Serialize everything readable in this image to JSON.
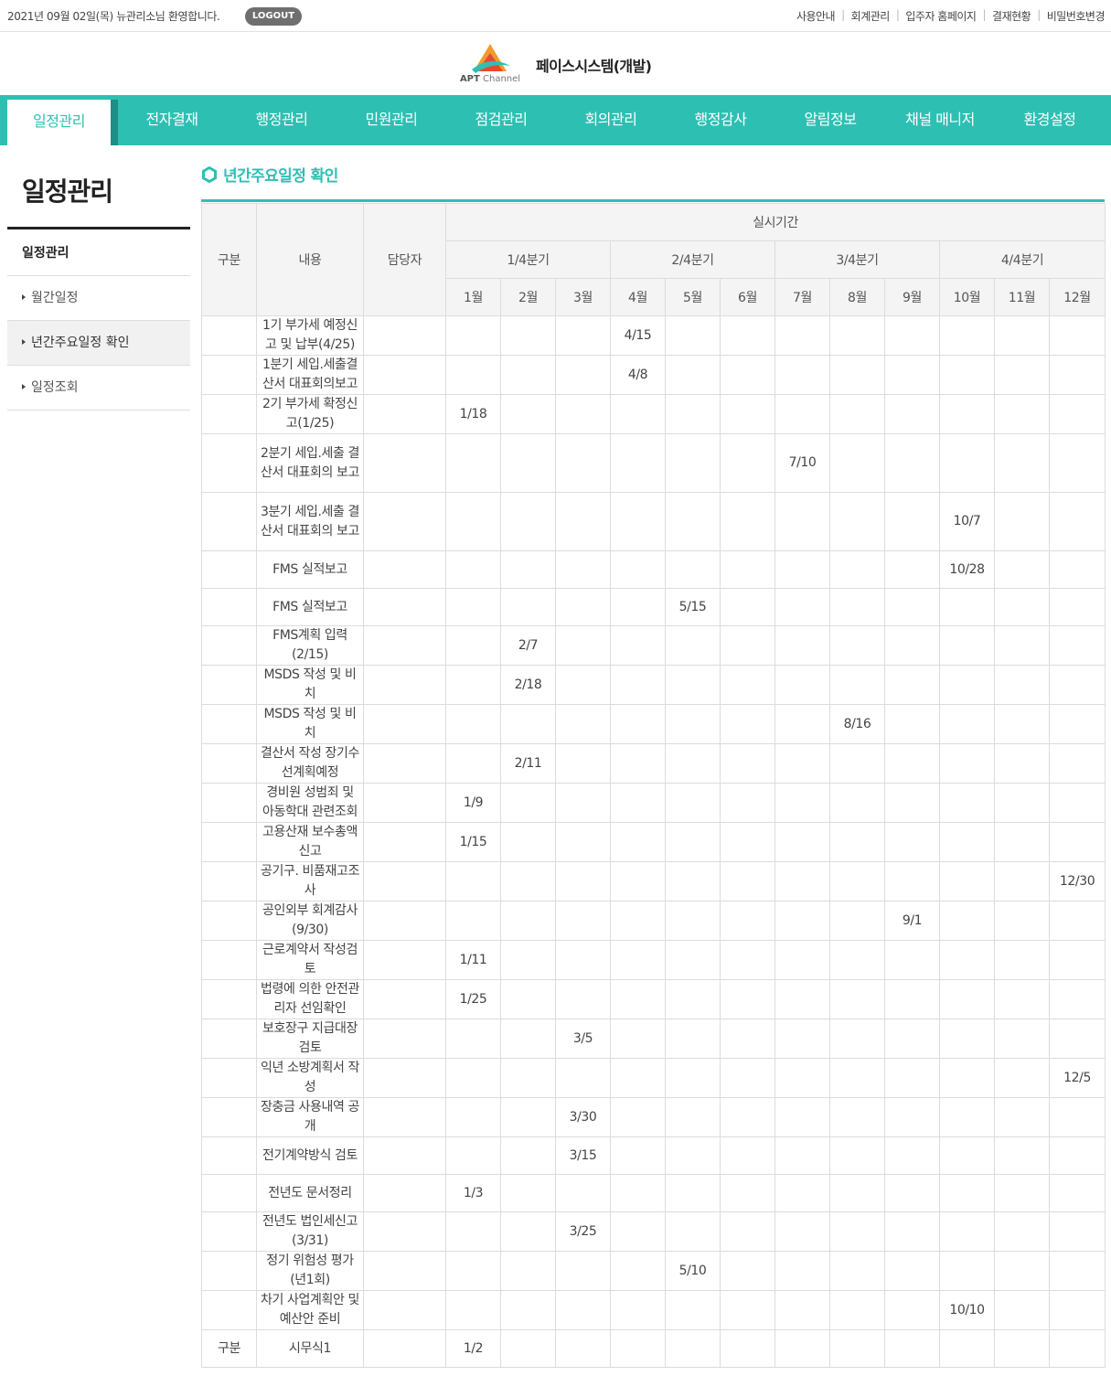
{
  "topbar": {
    "welcome": "2021년 09월 02일(목) 뉴관리소님 환영합니다.",
    "logout": "LOGOUT",
    "links": [
      "사용안내",
      "회계관리",
      "입주자 홈페이지",
      "결재현황",
      "비밀번호변경"
    ]
  },
  "header": {
    "logo_text_bold": "APT",
    "logo_text_rest": " Channel",
    "system_name": "페이스시스템(개발)"
  },
  "nav": {
    "items": [
      "일정관리",
      "전자결재",
      "행정관리",
      "민원관리",
      "점검관리",
      "회의관리",
      "행정감사",
      "알림정보",
      "채널 매니저",
      "환경설정"
    ],
    "active_index": 0
  },
  "sidebar": {
    "title": "일정관리",
    "head": "일정관리",
    "items": [
      "월간일정",
      "년간주요일정 확인",
      "일정조회"
    ],
    "selected_index": 1
  },
  "section": {
    "title": "년간주요일정 확인"
  },
  "table": {
    "headers": {
      "category": "구분",
      "content": "내용",
      "manager": "담당자",
      "period": "실시기간",
      "quarters": [
        "1/4분기",
        "2/4분기",
        "3/4분기",
        "4/4분기"
      ],
      "months": [
        "1월",
        "2월",
        "3월",
        "4월",
        "5월",
        "6월",
        "7월",
        "8월",
        "9월",
        "10월",
        "11월",
        "12월"
      ]
    },
    "rows": [
      {
        "category": "",
        "content": "1기 부가세 예정신고 및 납부(4/25)",
        "manager": "",
        "month": 4,
        "date": "4/15",
        "h": 43
      },
      {
        "category": "",
        "content": "1분기 세입.세출결산서 대표회의보고",
        "manager": "",
        "month": 4,
        "date": "4/8",
        "h": 43
      },
      {
        "category": "",
        "content": "2기 부가세 확정신고(1/25)",
        "manager": "",
        "month": 1,
        "date": "1/18",
        "h": 43
      },
      {
        "category": "",
        "content": "2분기 세입.세출 결산서 대표회의 보고",
        "manager": "",
        "month": 7,
        "date": "7/10",
        "h": 64
      },
      {
        "category": "",
        "content": "3분기 세입.세출 결산서 대표회의 보고",
        "manager": "",
        "month": 10,
        "date": "10/7",
        "h": 64
      },
      {
        "category": "",
        "content": "FMS 실적보고",
        "manager": "",
        "month": 10,
        "date": "10/28",
        "h": 41
      },
      {
        "category": "",
        "content": "FMS 실적보고",
        "manager": "",
        "month": 5,
        "date": "5/15",
        "h": 41
      },
      {
        "category": "",
        "content": "FMS계획 입력(2/15)",
        "manager": "",
        "month": 2,
        "date": "2/7",
        "h": 43
      },
      {
        "category": "",
        "content": "MSDS 작성 및 비치",
        "manager": "",
        "month": 2,
        "date": "2/18",
        "h": 43
      },
      {
        "category": "",
        "content": "MSDS 작성 및 비치",
        "manager": "",
        "month": 8,
        "date": "8/16",
        "h": 43
      },
      {
        "category": "",
        "content": "결산서 작성 장기수선계획예정",
        "manager": "",
        "month": 2,
        "date": "2/11",
        "h": 43
      },
      {
        "category": "",
        "content": "경비원 성범죄 및 아동학대 관련조회",
        "manager": "",
        "month": 1,
        "date": "1/9",
        "h": 43
      },
      {
        "category": "",
        "content": "고용산재 보수총액신고",
        "manager": "",
        "month": 1,
        "date": "1/15",
        "h": 43
      },
      {
        "category": "",
        "content": "공기구. 비품재고조사",
        "manager": "",
        "month": 12,
        "date": "12/30",
        "h": 43
      },
      {
        "category": "",
        "content": "공인외부 회계감사(9/30)",
        "manager": "",
        "month": 9,
        "date": "9/1",
        "h": 43
      },
      {
        "category": "",
        "content": "근로계약서 작성검토",
        "manager": "",
        "month": 1,
        "date": "1/11",
        "h": 43
      },
      {
        "category": "",
        "content": "법령에 의한 안전관리자 선임확인",
        "manager": "",
        "month": 1,
        "date": "1/25",
        "h": 43
      },
      {
        "category": "",
        "content": "보호장구 지급대장검토",
        "manager": "",
        "month": 3,
        "date": "3/5",
        "h": 43
      },
      {
        "category": "",
        "content": "익년 소방계획서 작성",
        "manager": "",
        "month": 12,
        "date": "12/5",
        "h": 43
      },
      {
        "category": "",
        "content": "장충금 사용내역 공개",
        "manager": "",
        "month": 3,
        "date": "3/30",
        "h": 43
      },
      {
        "category": "",
        "content": "전기계약방식 검토",
        "manager": "",
        "month": 3,
        "date": "3/15",
        "h": 41
      },
      {
        "category": "",
        "content": "전년도 문서정리",
        "manager": "",
        "month": 1,
        "date": "1/3",
        "h": 41
      },
      {
        "category": "",
        "content": "전년도 법인세신고(3/31)",
        "manager": "",
        "month": 3,
        "date": "3/25",
        "h": 43
      },
      {
        "category": "",
        "content": "정기 위험성 평가(년1회)",
        "manager": "",
        "month": 5,
        "date": "5/10",
        "h": 43
      },
      {
        "category": "",
        "content": "차기 사업계획안 및 예산안 준비",
        "manager": "",
        "month": 10,
        "date": "10/10",
        "h": 43
      },
      {
        "category": "구분",
        "content": "시무식1",
        "manager": "",
        "month": 1,
        "date": "1/2",
        "h": 41
      }
    ]
  },
  "colors": {
    "accent": "#2ebfb3",
    "accent_dark": "#1c8f86",
    "logo_orange": "#f29a2e",
    "logo_red": "#e64a2e",
    "logo_teal": "#2ebfb3"
  }
}
